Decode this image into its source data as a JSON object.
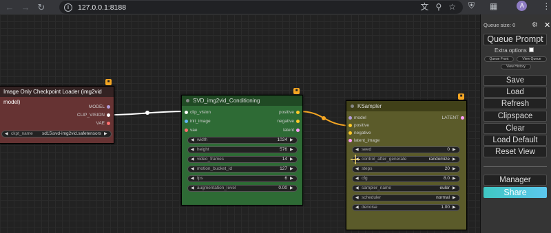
{
  "browser": {
    "url": "127.0.0.1:8188",
    "avatar_initial": "A"
  },
  "loader": {
    "title": "Image Only Checkpoint Loader (img2vid model)",
    "outputs": [
      "MODEL",
      "CLIP_VISION",
      "VAE"
    ],
    "widget_label": "ckpt_name",
    "widget_value": "sd15\\svd-img2vid.safetensors"
  },
  "svd": {
    "title": "SVD_img2vid_Conditioning",
    "inputs": [
      "clip_vision",
      "init_image",
      "vae"
    ],
    "outputs": [
      "positive",
      "negative",
      "latent"
    ],
    "widgets": [
      {
        "label": "width",
        "value": "1024"
      },
      {
        "label": "height",
        "value": "576"
      },
      {
        "label": "video_frames",
        "value": "14"
      },
      {
        "label": "motion_bucket_id",
        "value": "127"
      },
      {
        "label": "fps",
        "value": "6"
      },
      {
        "label": "augmentation_level",
        "value": "0.00"
      }
    ]
  },
  "ksampler": {
    "title": "KSampler",
    "inputs": [
      "model",
      "positive",
      "negative",
      "latent_image"
    ],
    "output": "LATENT",
    "widgets": [
      {
        "label": "seed",
        "value": "0"
      },
      {
        "label": "control_after_generate",
        "value": "randomize"
      },
      {
        "label": "steps",
        "value": "20"
      },
      {
        "label": "cfg",
        "value": "8.0"
      },
      {
        "label": "sampler_name",
        "value": "euler"
      },
      {
        "label": "scheduler",
        "value": "normal"
      },
      {
        "label": "denoise",
        "value": "1.00"
      }
    ]
  },
  "menu": {
    "queue_size": "Queue size: 0",
    "queue_prompt": "Queue Prompt",
    "extra_options": "Extra options",
    "queue_front": "Queue Front",
    "view_queue": "View Queue",
    "view_history": "View History",
    "save": "Save",
    "load": "Load",
    "refresh": "Refresh",
    "clipspace": "Clipspace",
    "clear": "Clear",
    "load_default": "Load Default",
    "reset_view": "Reset View",
    "manager": "Manager",
    "share": "Share"
  },
  "colors": {
    "loader_body": "#663333",
    "svd_body": "#2e6b35",
    "ksampler_body": "#5b5b2a",
    "link_clip": "#ffffff",
    "link_positive": "#f5a623",
    "share_gradient_start": "#3fc7c2",
    "share_gradient_end": "#5cc7ee"
  },
  "icons": {
    "back": "arrow-left-icon",
    "forward": "arrow-right-icon",
    "reload": "reload-icon",
    "info": "info-icon",
    "translate": "translate-icon",
    "zoom": "zoom-icon",
    "bookmark": "star-icon",
    "shield": "shield-icon",
    "extensions": "puzzle-icon",
    "more": "kebab-menu-icon",
    "settings": "gear-icon",
    "close": "close-icon"
  }
}
